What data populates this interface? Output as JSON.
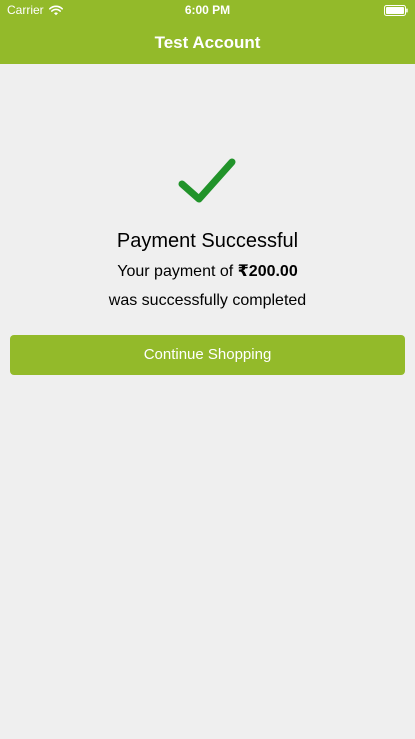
{
  "status_bar": {
    "carrier": "Carrier",
    "time": "6:00 PM",
    "wifi_icon": "wifi-icon",
    "battery_icon": "battery-icon"
  },
  "nav": {
    "title": "Test Account"
  },
  "payment": {
    "icon": "checkmark-icon",
    "title": "Payment Successful",
    "message_prefix": "Your payment of",
    "amount": "₹200.00",
    "message_suffix": "was successfully completed",
    "button_label": "Continue Shopping"
  },
  "colors": {
    "header": "#93ba2a",
    "button": "#93ba2a",
    "check": "#21932a",
    "background": "#efefef"
  }
}
